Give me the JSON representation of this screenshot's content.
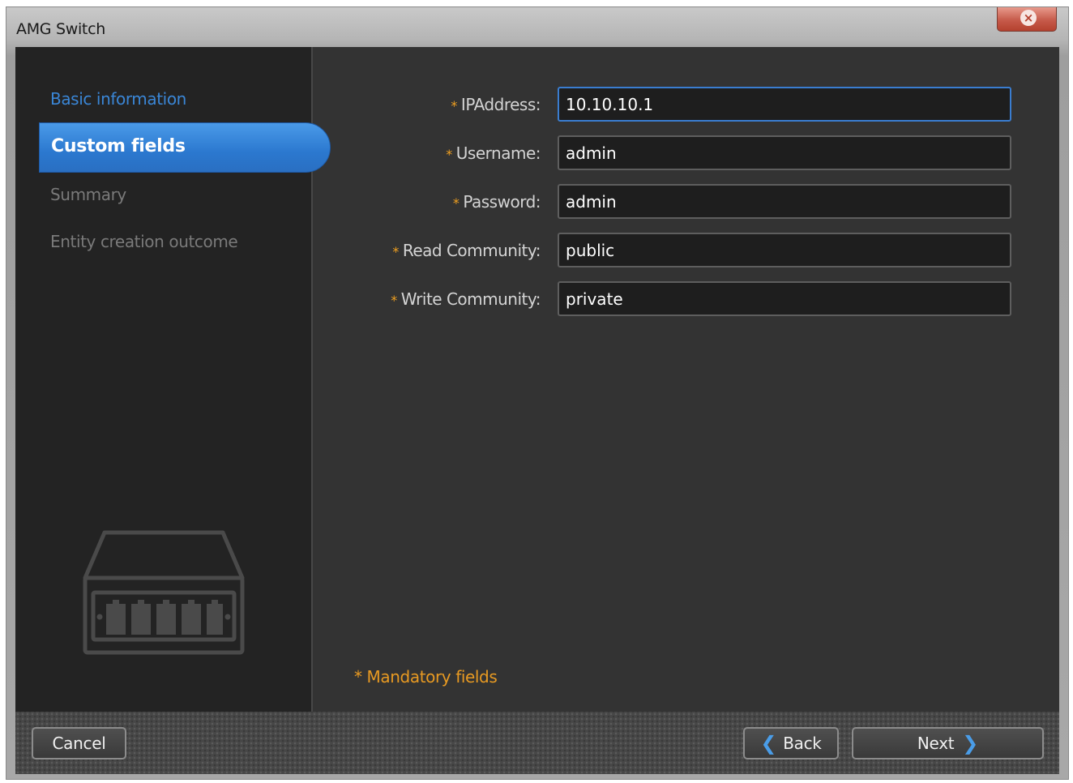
{
  "window": {
    "title": "AMG Switch",
    "close_icon": "close-icon"
  },
  "sidebar": {
    "items": [
      {
        "label": "Basic information",
        "state": "completed",
        "color": "#3a86d6"
      },
      {
        "label": "Custom fields",
        "state": "active",
        "color": "#2b78cf"
      },
      {
        "label": "Summary",
        "state": "pending",
        "color": "#7a7a7a"
      },
      {
        "label": "Entity creation outcome",
        "state": "pending",
        "color": "#7a7a7a"
      }
    ],
    "illustration_icon": "network-switch-icon"
  },
  "form": {
    "fields": [
      {
        "label": "IPAddress:",
        "value": "10.10.10.1",
        "required": true,
        "focused": true
      },
      {
        "label": "Username:",
        "value": "admin",
        "required": true
      },
      {
        "label": "Password:",
        "value": "admin",
        "required": true
      },
      {
        "label": "Read Community:",
        "value": "public",
        "required": true
      },
      {
        "label": "Write Community:",
        "value": "private",
        "required": true
      }
    ],
    "required_marker": "*",
    "mandatory_note": "* Mandatory fields",
    "accent_color": "#e89a22"
  },
  "footer": {
    "cancel_label": "Cancel",
    "back_label": "Back",
    "next_label": "Next"
  }
}
